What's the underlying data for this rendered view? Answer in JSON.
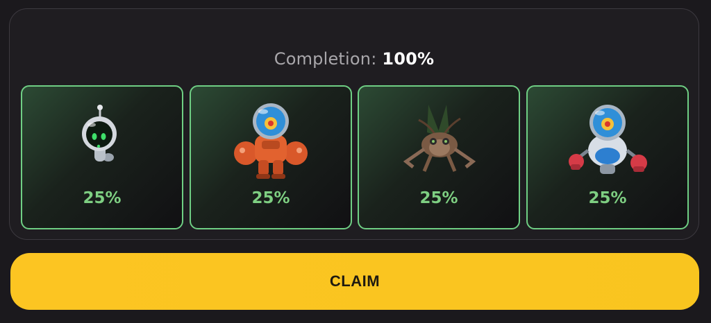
{
  "completion": {
    "label": "Completion: ",
    "value": "100%"
  },
  "cards": [
    {
      "icon": "small-drone-robot-icon",
      "percent": "25%"
    },
    {
      "icon": "orange-mech-robot-icon",
      "percent": "25%"
    },
    {
      "icon": "mechanical-bug-robot-icon",
      "percent": "25%"
    },
    {
      "icon": "boxer-robot-icon",
      "percent": "25%"
    }
  ],
  "claim_button": {
    "label": "CLAIM"
  },
  "colors": {
    "background": "#1b191d",
    "card_border": "#6fcf84",
    "percent_text": "#7ecf82",
    "claim_button": "#fcc522"
  }
}
